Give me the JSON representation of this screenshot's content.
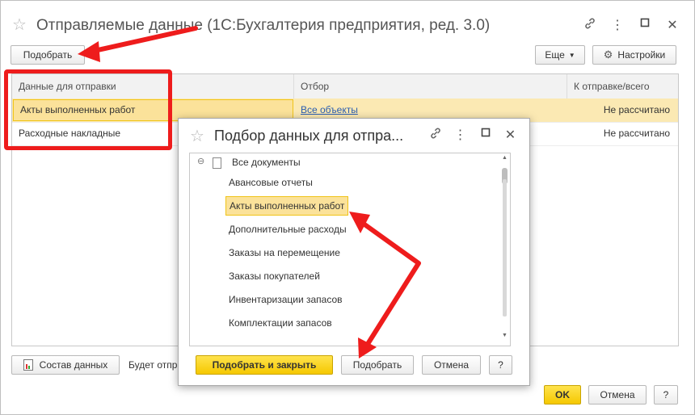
{
  "main_window": {
    "title": "Отправляемые данные (1С:Бухгалтерия предприятия, ред. 3.0)",
    "icons": [
      "link-icon",
      "more-icon",
      "maximize-icon",
      "close-icon"
    ],
    "toolbar": {
      "select_label": "Подобрать",
      "more_label": "Еще",
      "settings_label": "Настройки"
    },
    "table": {
      "columns": [
        "Данные для отправки",
        "Отбор",
        "К отправке/всего"
      ],
      "rows": [
        {
          "name": "Акты выполненных работ",
          "filter": "Все объекты",
          "count": "Не рассчитано"
        },
        {
          "name": "Расходные накладные",
          "filter": "",
          "count": "Не рассчитано"
        }
      ]
    },
    "bottom": {
      "data_composition_label": "Состав данных",
      "info_text": "Будет отпр",
      "ok_label": "OK",
      "cancel_label": "Отмена",
      "help_label": "?"
    }
  },
  "dialog": {
    "title": "Подбор данных для отпра...",
    "tree_root": "Все документы",
    "items": [
      "Авансовые отчеты",
      "Акты выполненных работ",
      "Дополнительные расходы",
      "Заказы на перемещение",
      "Заказы покупателей",
      "Инвентаризации запасов",
      "Комплектации запасов"
    ],
    "selected_index": 1,
    "buttons": {
      "select_close_label": "Подобрать и закрыть",
      "select_label": "Подобрать",
      "cancel_label": "Отмена",
      "help_label": "?"
    }
  },
  "colors": {
    "selected_row": "#fbe9b3",
    "highlight_border": "#f0c419",
    "annotation": "#ee1c1c",
    "link": "#2a5db0"
  }
}
